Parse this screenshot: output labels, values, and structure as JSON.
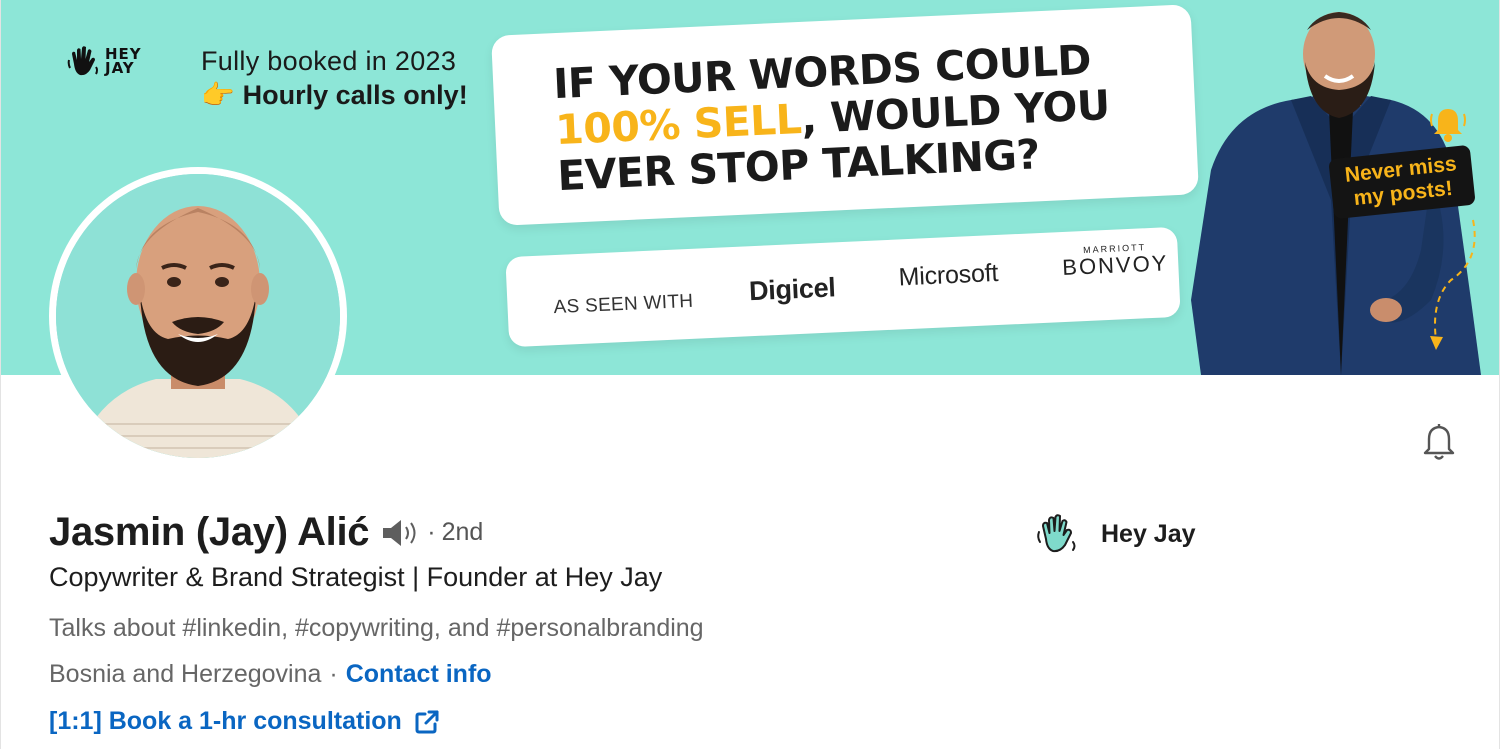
{
  "banner": {
    "logo_text_line1": "HEY",
    "logo_text_line2": "JAY",
    "booked_line1": "Fully booked in 2023",
    "booked_line2": "Hourly calls only!",
    "pointing_emoji": "👉",
    "quote_line1": "IF YOUR WORDS COULD",
    "quote_highlight": "100% SELL",
    "quote_line2_rest": ", WOULD YOU",
    "quote_line3": "EVER STOP TALKING?",
    "seen_with_label": "AS SEEN WITH",
    "partner_logos": [
      "Digicel",
      "Microsoft",
      "MARRIOTT",
      "BONVOY"
    ],
    "notif_tag": "Never miss my posts!",
    "colors": {
      "background": "#8de6d7",
      "highlight": "#f8b41a",
      "dark": "#141414"
    }
  },
  "profile": {
    "name": "Jasmin (Jay) Alić",
    "degree": "2nd",
    "headline": "Copywriter & Brand Strategist | Founder at Hey Jay",
    "talks_about": "Talks about #linkedin, #copywriting, and #personalbranding",
    "location": "Bosnia and Herzegovina",
    "contact_info_label": "Contact info",
    "consultation_label": "[1:1] Book a 1-hr consultation",
    "company_name": "Hey Jay",
    "link_color": "#0a66c2"
  },
  "icons": {
    "notification": "bell-icon",
    "pronunciation": "speaker-icon",
    "external_link": "external-link-icon",
    "company_logo": "waving-hand-icon"
  }
}
